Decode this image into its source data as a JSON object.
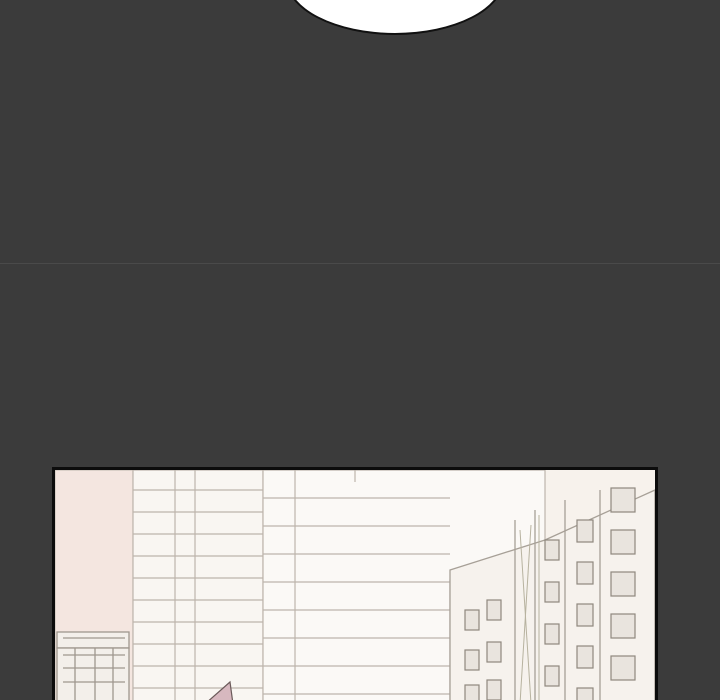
{
  "page": {
    "background_color": "#3b3b3b"
  },
  "speech_bubble": {
    "fill_color": "#ffffff",
    "outline_color": "#111111"
  },
  "panel": {
    "border_color": "#0c0c0c",
    "sky_color": "#f7f2ec",
    "line_color": "#b9b2aa"
  }
}
